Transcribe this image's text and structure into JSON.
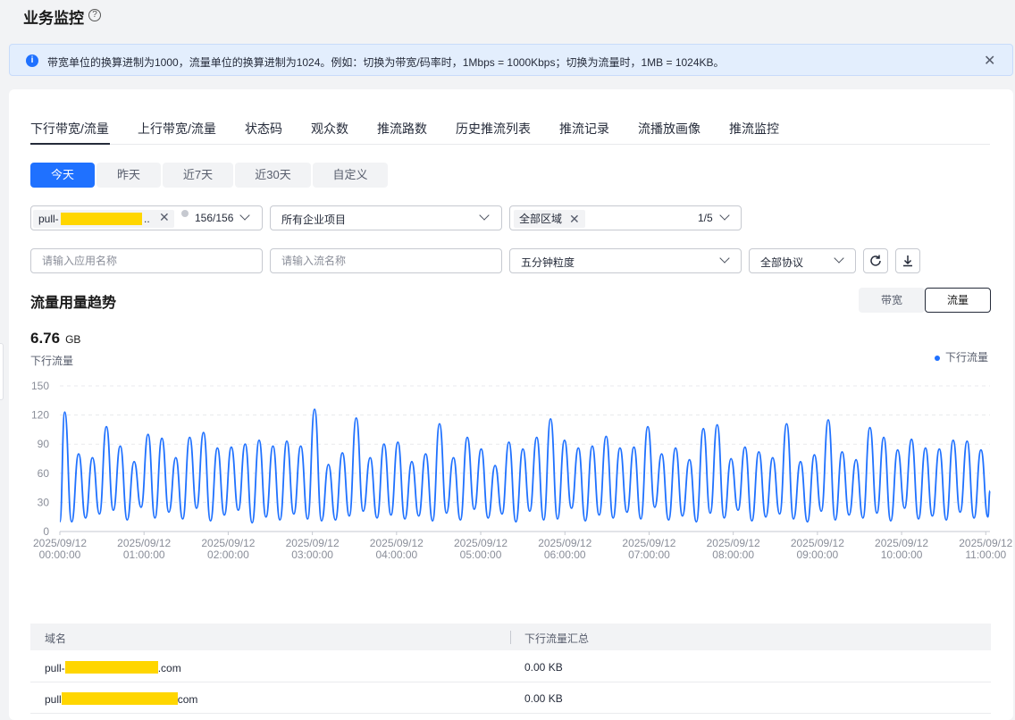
{
  "header": {
    "title": "业务监控",
    "help_icon": "question-circle-icon"
  },
  "notice": {
    "text": "带宽单位的换算进制为1000，流量单位的换算进制为1024。例如：切换为带宽/码率时，1Mbps = 1000Kbps；切换为流量时，1MB = 1024KB。"
  },
  "tabs": [
    {
      "label": "下行带宽/流量",
      "active": true
    },
    {
      "label": "上行带宽/流量"
    },
    {
      "label": "状态码"
    },
    {
      "label": "观众数"
    },
    {
      "label": "推流路数"
    },
    {
      "label": "历史推流列表"
    },
    {
      "label": "推流记录"
    },
    {
      "label": "流播放画像"
    },
    {
      "label": "推流监控"
    }
  ],
  "time_range": [
    "今天",
    "昨天",
    "近7天",
    "近30天",
    "自定义"
  ],
  "filters": {
    "domain_tag": "pull-",
    "domain_ellipsis": "..",
    "domain_count": "156/156",
    "project": "所有企业项目",
    "region_tag": "全部区域",
    "region_count": "1/5",
    "app_placeholder": "请输入应用名称",
    "stream_placeholder": "请输入流名称",
    "granularity": "五分钟粒度",
    "protocol": "全部协议"
  },
  "section": {
    "title": "流量用量趋势",
    "toggle_bandwidth": "带宽",
    "toggle_traffic": "流量",
    "metric_value": "6.76",
    "metric_unit": "GB",
    "metric_label": "下行流量",
    "legend": "下行流量"
  },
  "colors": {
    "accent": "#1f71ff",
    "redaction": "#ffd600"
  },
  "chart_data": {
    "type": "line",
    "ylim": [
      0,
      150
    ],
    "y_ticks": [
      0,
      30,
      60,
      90,
      120,
      150
    ],
    "x_ticks": [
      [
        "2025/09/12",
        "00:00:00"
      ],
      [
        "2025/09/12",
        "01:00:00"
      ],
      [
        "2025/09/12",
        "02:00:00"
      ],
      [
        "2025/09/12",
        "03:00:00"
      ],
      [
        "2025/09/12",
        "04:00:00"
      ],
      [
        "2025/09/12",
        "05:00:00"
      ],
      [
        "2025/09/12",
        "06:00:00"
      ],
      [
        "2025/09/12",
        "07:00:00"
      ],
      [
        "2025/09/12",
        "08:00:00"
      ],
      [
        "2025/09/12",
        "09:00:00"
      ],
      [
        "2025/09/12",
        "10:00:00"
      ],
      [
        "2025/09/12",
        "11:00:00"
      ]
    ],
    "x_range_hours": [
      0,
      11.05
    ],
    "series": [
      {
        "name": "下行流量",
        "peaks": [
          123,
          80,
          76,
          108,
          88,
          72,
          100,
          96,
          76,
          97,
          102,
          86,
          87,
          90,
          94,
          88,
          93,
          88,
          126,
          69,
          81,
          117,
          76,
          90,
          92,
          72,
          80,
          111,
          76,
          97,
          85,
          68,
          92,
          85,
          97,
          116,
          94,
          86,
          88,
          98,
          86,
          87,
          108,
          80,
          86,
          74,
          106,
          110,
          75,
          87,
          82,
          76,
          111,
          72,
          79,
          115,
          82,
          74,
          107,
          97,
          84,
          95,
          86,
          85,
          94,
          93,
          84
        ],
        "troughs": [
          10,
          14,
          18,
          22,
          12,
          25,
          14,
          20,
          13,
          24,
          11,
          17,
          22,
          9,
          15,
          12,
          18,
          13,
          11,
          12,
          16,
          21,
          14,
          17,
          13,
          16,
          11,
          19,
          12,
          23,
          14,
          18,
          10,
          21,
          12,
          13,
          24,
          11,
          17,
          14,
          20,
          13,
          25,
          12,
          16,
          10,
          19,
          14,
          22,
          11,
          15,
          18,
          13,
          10,
          21,
          12,
          17,
          14,
          19,
          11,
          24,
          13,
          16,
          12,
          20,
          14,
          15
        ]
      }
    ]
  },
  "table": {
    "columns": [
      "域名",
      "下行流量汇总"
    ],
    "rows": [
      {
        "prefix": "pull-",
        "suffix": ".com",
        "value": "0.00 KB"
      },
      {
        "prefix": "pull",
        "suffix": "com",
        "value": "0.00 KB"
      }
    ]
  }
}
